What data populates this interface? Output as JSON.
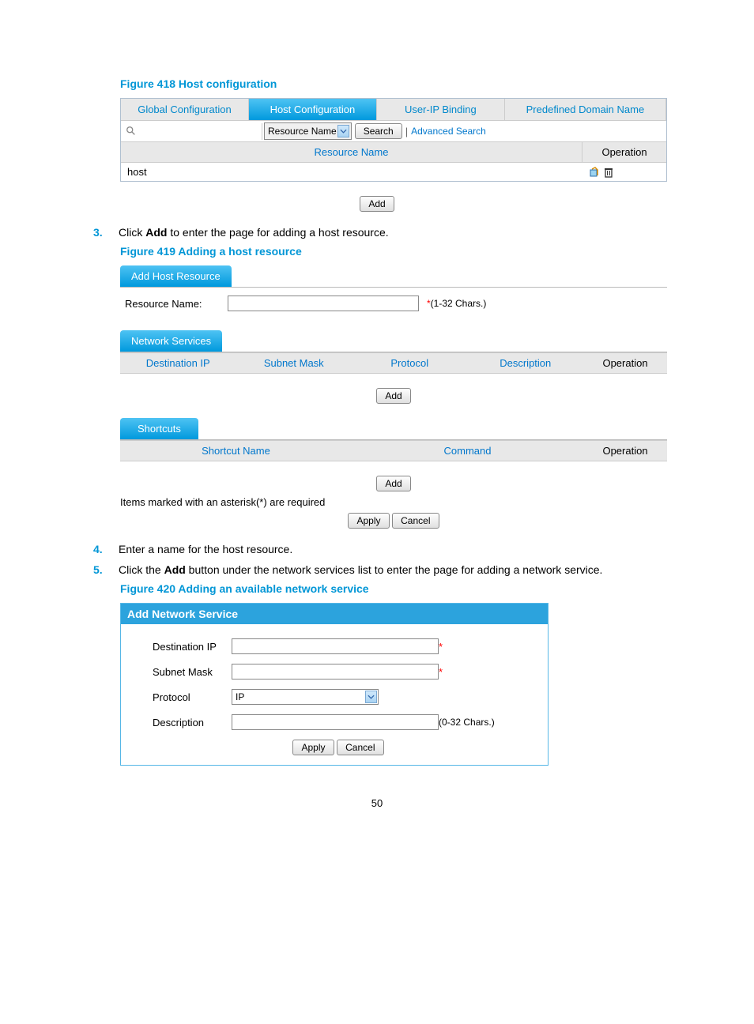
{
  "page_number": "50",
  "figures": {
    "f418_title": "Figure 418 Host configuration",
    "f419_title": "Figure 419 Adding a host resource",
    "f420_title": "Figure 420 Adding an available network service"
  },
  "steps": {
    "s3": {
      "num": "3.",
      "text_a": "Click ",
      "bold": "Add",
      "text_b": " to enter the page for adding a host resource."
    },
    "s4": {
      "num": "4.",
      "text": "Enter a name for the host resource."
    },
    "s5": {
      "num": "5.",
      "text_a": "Click the ",
      "bold": "Add",
      "text_b": " button under the network services list to enter the page for adding a network service."
    }
  },
  "f418": {
    "tabs": [
      "Global Configuration",
      "Host Configuration",
      "User-IP Binding",
      "Predefined Domain Name"
    ],
    "search_dropdown": "Resource Name",
    "search_button": "Search",
    "advanced": "Advanced Search",
    "th_resource": "Resource Name",
    "th_op": "Operation",
    "row_host": "host",
    "add": "Add"
  },
  "f419": {
    "add_tab": "Add Host Resource",
    "resource_label": "Resource Name:",
    "resource_hint": "(1-32 Chars.)",
    "net_tab": "Network Services",
    "cols": [
      "Destination IP",
      "Subnet Mask",
      "Protocol",
      "Description",
      "Operation"
    ],
    "add": "Add",
    "short_tab": "Shortcuts",
    "short_cols": [
      "Shortcut Name",
      "Command",
      "Operation"
    ],
    "add2": "Add",
    "note": "Items marked with an asterisk(*) are required",
    "apply": "Apply",
    "cancel": "Cancel"
  },
  "f420": {
    "header": "Add Network Service",
    "dest_label": "Destination IP",
    "subnet_label": "Subnet Mask",
    "proto_label": "Protocol",
    "proto_value": "IP",
    "desc_label": "Description",
    "desc_hint": "(0-32 Chars.)",
    "apply": "Apply",
    "cancel": "Cancel"
  }
}
